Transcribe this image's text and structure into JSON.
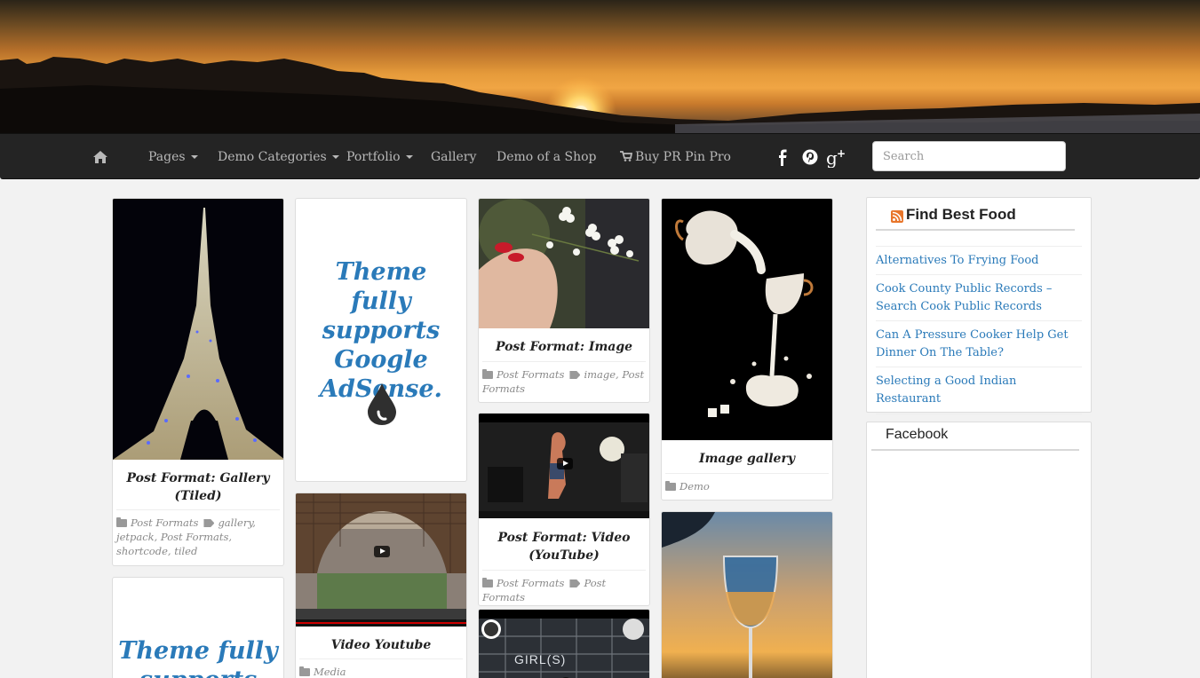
{
  "nav": {
    "home_icon": "home-icon",
    "items": [
      {
        "label": "Pages",
        "dropdown": true
      },
      {
        "label": "Demo Categories",
        "dropdown": true
      },
      {
        "label": "Portfolio",
        "dropdown": true
      },
      {
        "label": "Gallery",
        "dropdown": false
      },
      {
        "label": "Demo of a Shop",
        "dropdown": false
      },
      {
        "label": "Buy PR Pin Pro",
        "icon": "cart-icon"
      }
    ],
    "social": [
      "facebook-icon",
      "pinterest-icon",
      "google-plus-icon"
    ],
    "search_placeholder": "Search"
  },
  "posts": {
    "gallery_tiled": {
      "title": "Post Format: Gallery (Tiled)",
      "category": "Post Formats",
      "tags": "gallery, jetpack, Post Formats, shortcode, tiled"
    },
    "adsense_1": {
      "text": "Theme fully supports Google AdSense."
    },
    "adsense_2": {
      "text": "Theme fully supports"
    },
    "video_youtube": {
      "title": "Video Youtube",
      "category": "Media"
    },
    "image": {
      "title": "Post Format: Image",
      "category": "Post Formats",
      "tags": "image, Post Formats"
    },
    "video": {
      "title": "Post Format: Video (YouTube)",
      "category": "Post Formats",
      "tags": "Post Formats"
    },
    "video2_caption": "GIRL(S)",
    "image_gallery": {
      "title": "Image gallery",
      "category": "Demo"
    }
  },
  "sidebar": {
    "food_widget": {
      "title": "Find Best Food",
      "links": [
        "Alternatives To Frying Food",
        "Cook County Public Records – Search Cook Public Records",
        "Can A Pressure Cooker Help Get Dinner On The Table?",
        "Selecting a Good Indian Restaurant"
      ]
    },
    "facebook_widget": {
      "title": "Facebook"
    }
  },
  "colors": {
    "navbar": "#242424",
    "link": "#2a7ab9",
    "adsense": "#2a7ab9"
  }
}
